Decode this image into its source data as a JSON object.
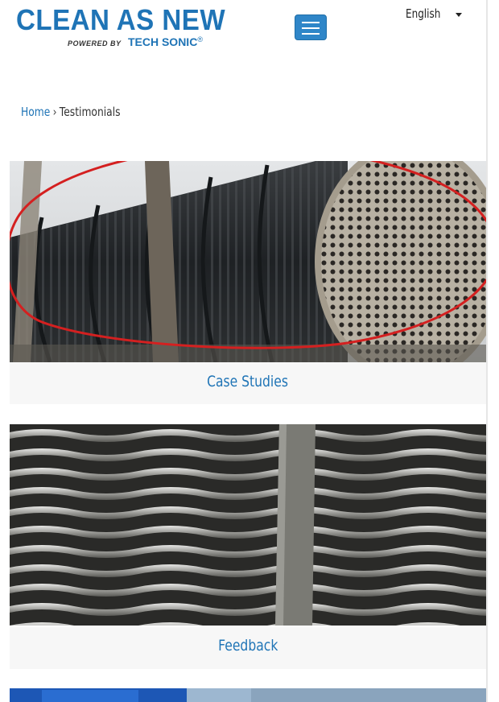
{
  "header": {
    "logo_main": "CLEAN AS NEW",
    "logo_powered": "POWERED BY",
    "logo_brand": "TECH SONIC",
    "logo_reg": "®",
    "menu_icon": "hamburger-menu-icon",
    "language": "English",
    "language_icon": "caret-down-icon"
  },
  "breadcrumb": {
    "home": "Home",
    "separator": "›",
    "current": "Testimonials"
  },
  "cards": [
    {
      "caption": "Case Studies",
      "image": "heat-exchanger-tube-bundle"
    },
    {
      "caption": "Feedback",
      "image": "plate-heat-exchanger-fins"
    },
    {
      "caption": "",
      "image": "industrial-equipment-blue"
    }
  ],
  "colors": {
    "brand_blue": "#1f74b6",
    "menu_button": "#2f86c8",
    "annotation_red": "#d42020"
  }
}
